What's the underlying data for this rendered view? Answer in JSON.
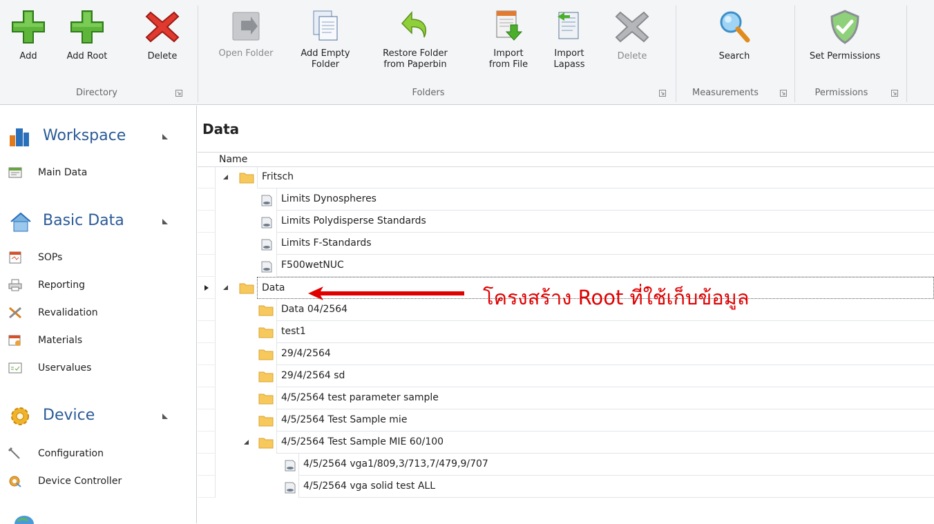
{
  "ribbon": {
    "directory": {
      "label": "Directory",
      "add": "Add",
      "add_root": "Add Root",
      "delete": "Delete"
    },
    "folders": {
      "label": "Folders",
      "open_folder": "Open Folder",
      "add_empty_folder_l1": "Add Empty",
      "add_empty_folder_l2": "Folder",
      "restore_l1": "Restore Folder",
      "restore_l2": "from Paperbin",
      "import_file_l1": "Import",
      "import_file_l2": "from File",
      "import_lapass_l1": "Import",
      "import_lapass_l2": "Lapass",
      "delete": "Delete"
    },
    "measurements": {
      "label": "Measurements",
      "search": "Search"
    },
    "permissions": {
      "label": "Permissions",
      "set_permissions": "Set Permissions"
    }
  },
  "sidebar": {
    "workspace": {
      "title": "Workspace",
      "items": [
        "Main Data"
      ]
    },
    "basic_data": {
      "title": "Basic Data",
      "items": [
        "SOPs",
        "Reporting",
        "Revalidation",
        "Materials",
        "Uservalues"
      ]
    },
    "device": {
      "title": "Device",
      "items": [
        "Configuration",
        "Device Controller"
      ]
    }
  },
  "main": {
    "title": "Data",
    "column_name": "Name",
    "rows": [
      "Fritsch",
      "Limits  Dynospheres",
      "Limits Polydisperse Standards",
      "Limits F-Standards",
      "F500wetNUC",
      "Data",
      "Data 04/2564",
      "test1",
      "29/4/2564",
      "29/4/2564 sd",
      "4/5/2564 test parameter sample",
      "4/5/2564 Test Sample mie",
      "4/5/2564 Test Sample MIE 60/100",
      "4/5/2564 vga1/809,3/713,7/479,9/707",
      "4/5/2564 vga solid test ALL"
    ]
  },
  "annotation": {
    "text": "โครงสร้าง Root ที่ใช้เก็บข้อมูล",
    "color": "#e00000"
  }
}
